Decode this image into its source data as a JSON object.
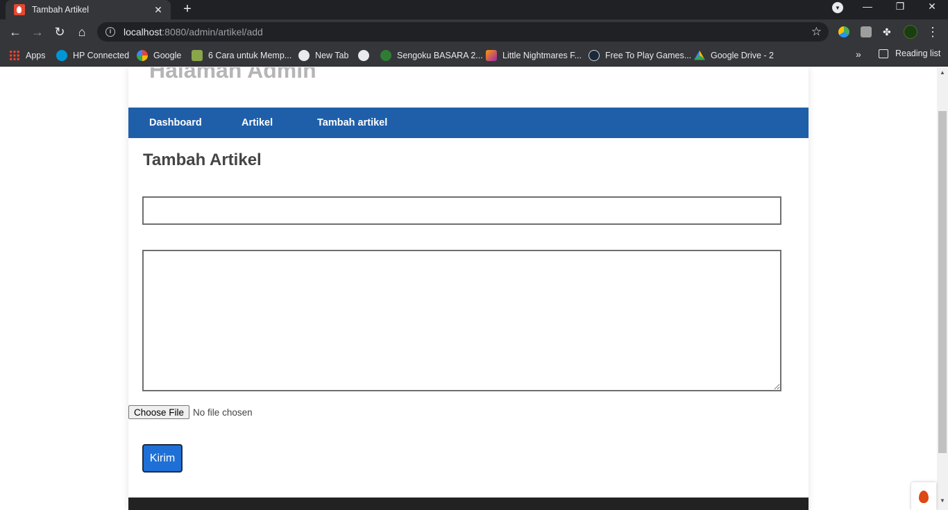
{
  "browser": {
    "tab": {
      "title": "Tambah Artikel",
      "close": "✕"
    },
    "new_tab": "+",
    "window_controls": {
      "minimize": "—",
      "restore": "❐",
      "close": "✕"
    },
    "address": {
      "host": "localhost",
      "path": ":8080/admin/artikel/add"
    },
    "bookmarks": [
      {
        "label": "Apps",
        "icon": "apps-grid-icon"
      },
      {
        "label": "HP Connected",
        "icon": "hp-icon"
      },
      {
        "label": "Google",
        "icon": "google-icon"
      },
      {
        "label": "6 Cara untuk Memp...",
        "icon": "wikihow-icon"
      },
      {
        "label": "New Tab",
        "icon": "globe-icon"
      },
      {
        "label": "",
        "icon": "globe-icon"
      },
      {
        "label": "Sengoku BASARA 2...",
        "icon": "site-icon"
      },
      {
        "label": "Little Nightmares F...",
        "icon": "folder-icon"
      },
      {
        "label": "Free To Play Games...",
        "icon": "steam-icon"
      },
      {
        "label": "Google Drive - 2",
        "icon": "drive-icon"
      }
    ],
    "bookmarks_more": "»",
    "reading_list": "Reading list"
  },
  "page": {
    "site_title": "Halaman Admin",
    "nav": [
      "Dashboard",
      "Artikel",
      "Tambah artikel"
    ],
    "heading": "Tambah Artikel",
    "title_input": {
      "value": "",
      "placeholder": ""
    },
    "content_textarea": {
      "value": "",
      "placeholder": ""
    },
    "file_input": {
      "button": "Choose File",
      "status": "No file chosen"
    },
    "submit": "Kirim"
  }
}
